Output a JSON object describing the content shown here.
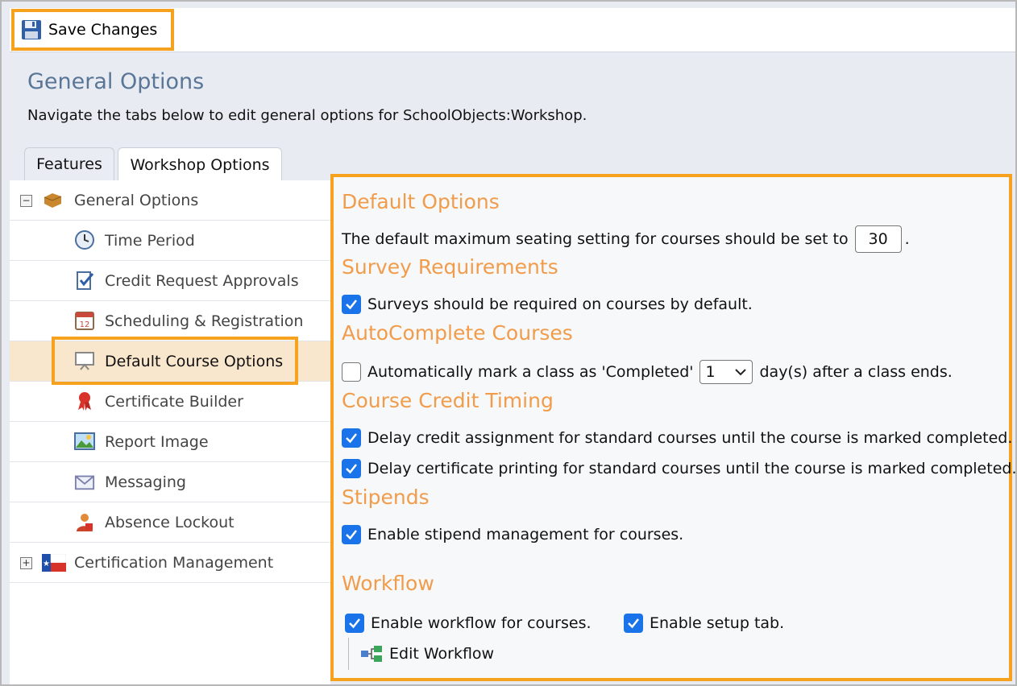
{
  "toolbar": {
    "save_label": "Save Changes",
    "save_icon": "floppy-disk-icon"
  },
  "header": {
    "title": "General Options",
    "description": "Navigate the tabs below to edit general options for SchoolObjects:Workshop."
  },
  "tabs": [
    {
      "label": "Features",
      "active": false
    },
    {
      "label": "Workshop Options",
      "active": true
    }
  ],
  "tree": {
    "items": [
      {
        "label": "General Options",
        "icon": "briefcase-icon",
        "expander": "−",
        "level": 0
      },
      {
        "label": "Time Period",
        "icon": "clock-icon",
        "level": 1
      },
      {
        "label": "Credit Request Approvals",
        "icon": "clipboard-check-icon",
        "level": 1
      },
      {
        "label": "Scheduling & Registration",
        "icon": "calendar-icon",
        "level": 1
      },
      {
        "label": "Default Course Options",
        "icon": "presentation-board-icon",
        "level": 1,
        "selected": true
      },
      {
        "label": "Certificate Builder",
        "icon": "ribbon-icon",
        "level": 1
      },
      {
        "label": "Report Image",
        "icon": "picture-icon",
        "level": 1
      },
      {
        "label": "Messaging",
        "icon": "envelope-icon",
        "level": 1
      },
      {
        "label": "Absence Lockout",
        "icon": "person-lock-icon",
        "level": 1
      },
      {
        "label": "Certification Management",
        "icon": "texas-flag-icon",
        "expander": "+",
        "level": 0
      }
    ]
  },
  "panel": {
    "default_options": {
      "heading": "Default Options",
      "seating_text": "The default maximum seating setting for courses should be set to",
      "seating_value": "30",
      "seating_suffix": "."
    },
    "survey": {
      "heading": "Survey Requirements",
      "checkbox_label": "Surveys should be required on courses by default.",
      "checked": true
    },
    "autocomplete": {
      "heading": "AutoComplete Courses",
      "label_before": "Automatically mark a class as 'Completed'",
      "days_value": "1",
      "label_after": "day(s) after a class ends.",
      "checked": false
    },
    "credit_timing": {
      "heading": "Course Credit Timing",
      "credit_label": "Delay credit assignment for standard courses until the course is marked completed.",
      "certificate_label": "Delay certificate printing for standard courses until the course is marked completed."
    },
    "stipends": {
      "heading": "Stipends",
      "label": "Enable stipend management for courses."
    },
    "workflow": {
      "heading": "Workflow",
      "enable_label": "Enable workflow for courses.",
      "setup_label": "Enable setup tab.",
      "edit_label": "Edit Workflow"
    }
  },
  "colors": {
    "accent": "#f6a21e",
    "heading": "#f19c4b",
    "title": "#5a7697",
    "checkbox": "#1a73e8"
  }
}
